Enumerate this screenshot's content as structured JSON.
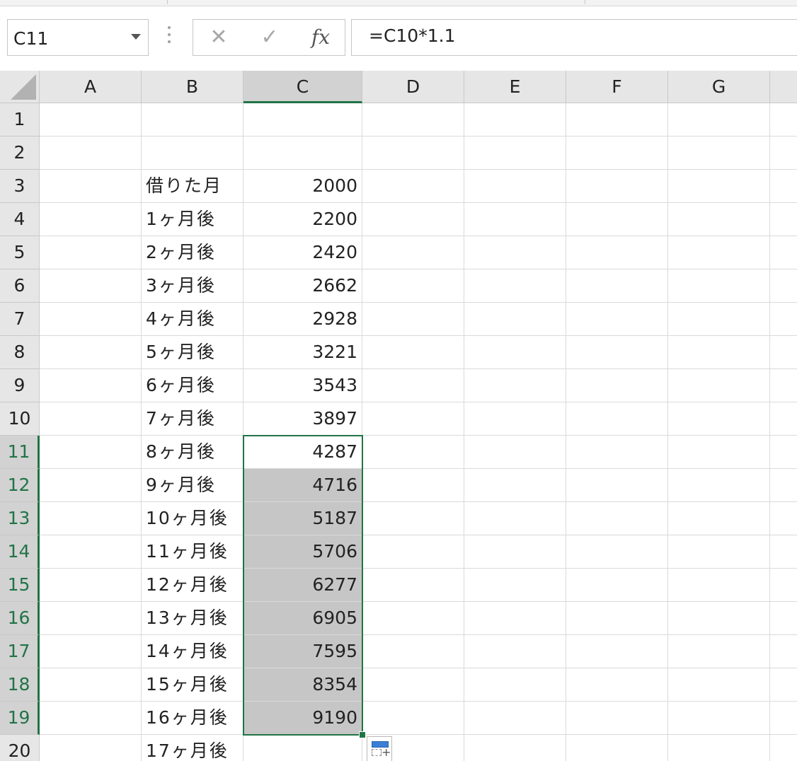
{
  "name_box": {
    "value": "C11"
  },
  "formula_bar": {
    "cancel_icon": "✕",
    "enter_icon": "✓",
    "fx_label": "fx",
    "formula": "=C10*1.1"
  },
  "columns": [
    "A",
    "B",
    "C",
    "D",
    "E",
    "F",
    "G"
  ],
  "selected_column": "C",
  "rows": [
    {
      "num": "1",
      "b": "",
      "c": ""
    },
    {
      "num": "2",
      "b": "",
      "c": ""
    },
    {
      "num": "3",
      "b": "借りた月",
      "c": "2000"
    },
    {
      "num": "4",
      "b": "1ヶ月後",
      "c": "2200"
    },
    {
      "num": "5",
      "b": "2ヶ月後",
      "c": "2420"
    },
    {
      "num": "6",
      "b": "3ヶ月後",
      "c": "2662"
    },
    {
      "num": "7",
      "b": "4ヶ月後",
      "c": "2928"
    },
    {
      "num": "8",
      "b": "5ヶ月後",
      "c": "3221"
    },
    {
      "num": "9",
      "b": "6ヶ月後",
      "c": "3543"
    },
    {
      "num": "10",
      "b": "7ヶ月後",
      "c": "3897"
    },
    {
      "num": "11",
      "b": "8ヶ月後",
      "c": "4287"
    },
    {
      "num": "12",
      "b": "9ヶ月後",
      "c": "4716"
    },
    {
      "num": "13",
      "b": "10ヶ月後",
      "c": "5187"
    },
    {
      "num": "14",
      "b": "11ヶ月後",
      "c": "5706"
    },
    {
      "num": "15",
      "b": "12ヶ月後",
      "c": "6277"
    },
    {
      "num": "16",
      "b": "13ヶ月後",
      "c": "6905"
    },
    {
      "num": "17",
      "b": "14ヶ月後",
      "c": "7595"
    },
    {
      "num": "18",
      "b": "15ヶ月後",
      "c": "8354"
    },
    {
      "num": "19",
      "b": "16ヶ月後",
      "c": "9190"
    },
    {
      "num": "20",
      "b": "17ヶ月後",
      "c": ""
    }
  ],
  "selection": {
    "active_row": "11",
    "range_start_row": "11",
    "range_end_row": "19",
    "column": "C"
  },
  "colors": {
    "accent": "#217346",
    "selection_fill": "#c6c6c6",
    "header_bg": "#e6e6e6"
  }
}
